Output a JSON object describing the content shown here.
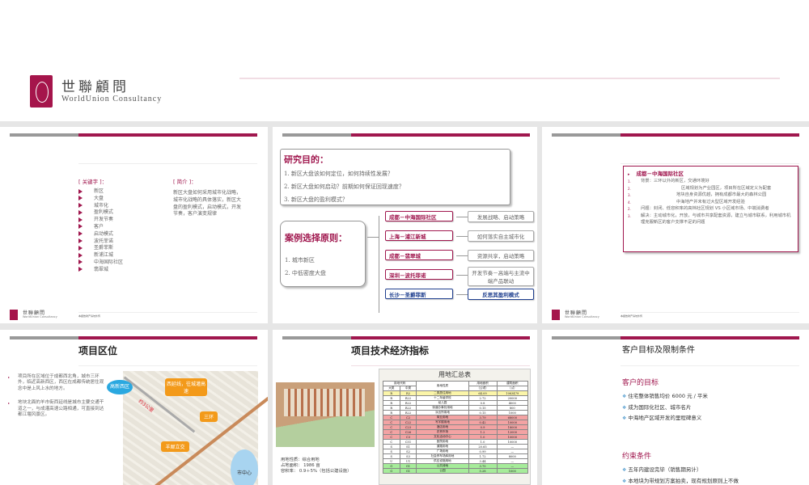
{
  "brand": {
    "cn": "世聯顧問",
    "en": "WorldUnion Consultancy",
    "footnote": "本报告财产请勿外传"
  },
  "colors": {
    "accent": "#a0174e",
    "grey_bar": "#999999"
  },
  "slide2": {
    "keywords_label": "[ 关键字 ]：",
    "keywords": [
      "新区",
      "大盘",
      "城市化",
      "盈利模式",
      "开发节奏",
      "客户",
      "启动模式",
      "波托菲诺",
      "圣爵菲斯",
      "新浦江城",
      "中海国际社区",
      "翡翠城"
    ],
    "intro_label": "[ 简介 ]：",
    "intro": "新区大盘如何采用城市化战略，城市化战略的具体落实，新区大盘的盈利模式，启动模式，开发节奏，客户演变规律"
  },
  "slide3": {
    "purpose_title": "研究目的：",
    "purposes": [
      "1. 新区大盘该如何定位，如何持续性发展？",
      "2. 新区大盘如何启动？前期如何保证回现速度？",
      "3. 新区大盘的盈利模式？"
    ],
    "principle_title": "案例选择原则：",
    "principles": [
      "1. 城市新区",
      "2. 中低密度大盘"
    ],
    "cases": [
      {
        "name": "成都－中海国际社区",
        "result": "发展战略、启动策略"
      },
      {
        "name": "上海－浦江新城",
        "result": "如何落实自主城市化"
      },
      {
        "name": "成都－翡翠城",
        "result": "资源共享，启动策略"
      },
      {
        "name": "深圳－波托菲诺",
        "result": "开发节奏－高端与主流中端产品联动"
      },
      {
        "name": "长沙－圣爵菲斯",
        "result": "反思其盈利模式"
      }
    ]
  },
  "slide4": {
    "title": "成都－中海国际社区",
    "items": [
      {
        "n": "1.",
        "t": "背景：三环以外的新区，交通环境好"
      },
      {
        "n": "2.",
        "t": "区域规划为产业园区，项目所在区域定义为配套"
      },
      {
        "n": "3.",
        "t": "地块自身资源优越，拥有成都市最大的森林公园"
      },
      {
        "n": "4.",
        "t": "中海地产并未有过大型区域开发经验"
      },
      {
        "n": "2.",
        "t": "问题：封闭、低容积率的高档社区规划 VS 小区域市场、中端消费者"
      },
      {
        "n": "3.",
        "t": "解决：主动城市化，开放，与城市共享配套资源，建立与城市联系，利用城市机理克服新区的客户支撑不足的问题"
      }
    ]
  },
  "slide5": {
    "title": "项目区位",
    "bullets": [
      "项目所在区域位于成都西北角，城市三环外，临近高新西区，西区在成都传统居住观念中是上风上水的地方。",
      "地块北面的羊市街西延线是城市主要交通干道之一，与成灌高速公路相通，可直接到达都江堰风景区。"
    ],
    "map_labels": {
      "west_zone": "高新西区",
      "road": "西延线，往城灌高速",
      "distance": "约3公里",
      "ring": "三环",
      "interchange": "羊犀立交",
      "center": "市中心"
    }
  },
  "slide6": {
    "title": "项目技术经济指标",
    "table_title": "用地汇总表",
    "headers": {
      "code": "用地代码",
      "major": "大类",
      "mid": "中类",
      "nature": "用地性质",
      "area": "用地面积",
      "area_unit": "（公顷）",
      "floor": "建筑面积",
      "floor_unit": "（㎡）"
    },
    "rows": [
      [
        "R",
        "R2",
        "二类居住用地",
        "64.09",
        "1083479",
        "y"
      ],
      [
        "R",
        "R22",
        "十二年级学校",
        "2.72",
        "20000",
        ""
      ],
      [
        "R",
        "R22",
        "幼儿园",
        "0.8",
        "4000",
        ""
      ],
      [
        "R",
        "R22",
        "街道办事处用地",
        "0.15",
        "800",
        ""
      ],
      [
        "R",
        "R22",
        "派出所用地",
        "0.15",
        "1000",
        ""
      ],
      [
        "C",
        "C2",
        "商业用地",
        "3.79",
        "68000",
        "r"
      ],
      [
        "C",
        "C22",
        "写字楼用地",
        "0.42",
        "10000",
        "r"
      ],
      [
        "C",
        "C23",
        "酒店用地",
        "0.9",
        "18000",
        "r"
      ],
      [
        "C",
        "C26",
        "农贸市场",
        "1.2",
        "12000",
        "r"
      ],
      [
        "C",
        "C3",
        "文化活动中心",
        "1.0",
        "10000",
        "r"
      ],
      [
        "C",
        "C51",
        "医院用地",
        "1.0",
        "10000",
        ""
      ],
      [
        "S",
        "S1",
        "道路用地",
        "20.65",
        "—",
        ""
      ],
      [
        "S",
        "S2",
        "广场用地",
        "0.99",
        "—",
        ""
      ],
      [
        "S",
        "S3",
        "社会停车场库用地",
        "1.72",
        "8000",
        ""
      ],
      [
        "U",
        "U1",
        "供应设施用地",
        "3.44",
        "—",
        ""
      ],
      [
        "G",
        "G1",
        "公共绿地",
        "3.75",
        "—",
        "g"
      ],
      [
        "G",
        "G1",
        "公园",
        "5.28",
        "1000",
        "g"
      ]
    ],
    "info": [
      "用地性质：综合用地",
      "占地面积：  1986 亩",
      "容积率：    0.9＋5%（包括公建设施）"
    ]
  },
  "slide7": {
    "title": "客户目标及限制条件",
    "goal_title": "客户的目标",
    "goals": [
      "住宅整体销售均价 6000 元 / 平米",
      "成为国际化社区、城市名片",
      "中海地产区域开发的里程碑意义"
    ],
    "limit_title": "约束条件",
    "limits": [
      "五年内建设完毕（销售期另计）",
      "本地块为带规划方案拍卖，现有规划原则上不做"
    ]
  }
}
